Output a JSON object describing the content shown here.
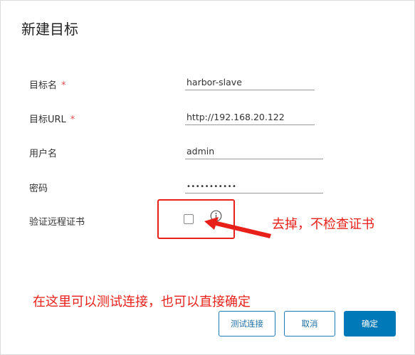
{
  "dialog": {
    "title": "新建目标"
  },
  "form": {
    "target_name": {
      "label": "目标名",
      "required_mark": "*",
      "value": "harbor-slave"
    },
    "target_url": {
      "label": "目标URL",
      "required_mark": "*",
      "value": "http://192.168.20.122"
    },
    "username": {
      "label": "用户名",
      "value": "admin"
    },
    "password": {
      "label": "密码",
      "masked_value": "•••••••••••"
    },
    "verify_cert": {
      "label": "验证远程证书",
      "checked": false
    }
  },
  "annotations": {
    "checkbox_note": "去掉，不检查证书",
    "bottom_note": "在这里可以测试连接，也可以直接确定"
  },
  "buttons": {
    "test_connection": "测试连接",
    "cancel": "取消",
    "confirm": "确定"
  },
  "colors": {
    "annotation_red": "#e8201a",
    "primary_blue": "#0079b8",
    "required_red": "#e05050"
  }
}
